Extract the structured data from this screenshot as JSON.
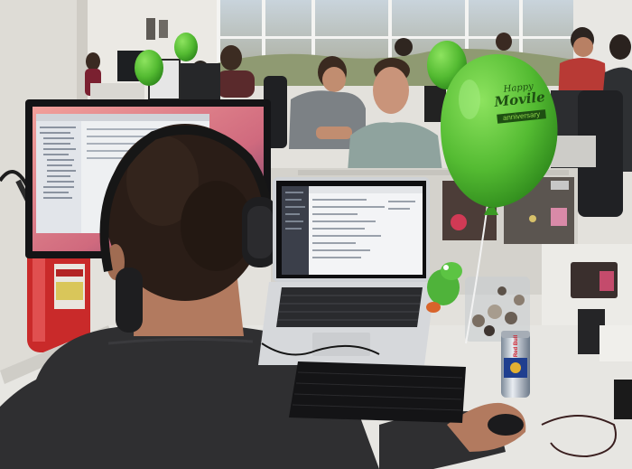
{
  "scene": {
    "balloon_text": {
      "line1": "Happy",
      "line2": "Movile",
      "line3": "anniversary"
    },
    "can_text": "Red Bull"
  },
  "colors": {
    "balloon": "#5cc43a",
    "balloon_dark": "#3f9a24",
    "wall": "#e8e6e1",
    "desk": "#e4e3de",
    "shirt": "#2f2f31",
    "hair": "#2a1d17"
  }
}
